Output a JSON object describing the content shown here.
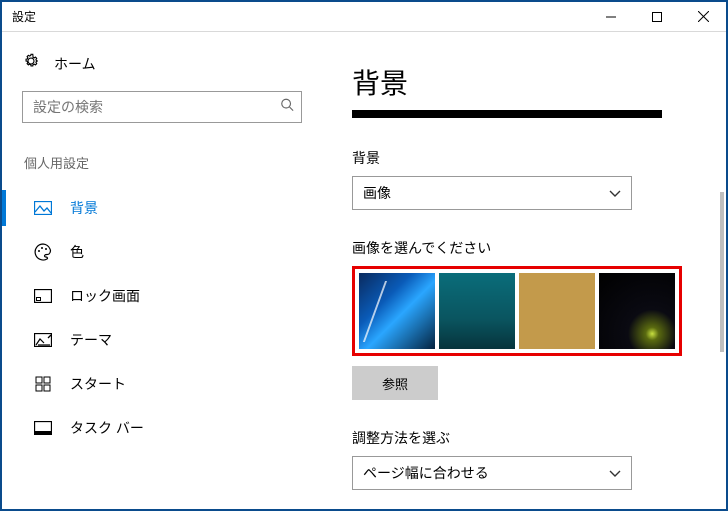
{
  "window": {
    "title": "設定"
  },
  "sidebar": {
    "home": "ホーム",
    "search_placeholder": "設定の検索",
    "section_header": "個人用設定",
    "items": [
      {
        "label": "背景",
        "icon": "picture-icon",
        "active": true
      },
      {
        "label": "色",
        "icon": "palette-icon"
      },
      {
        "label": "ロック画面",
        "icon": "lockscreen-icon"
      },
      {
        "label": "テーマ",
        "icon": "theme-icon"
      },
      {
        "label": "スタート",
        "icon": "start-icon"
      },
      {
        "label": "タスク バー",
        "icon": "taskbar-icon"
      }
    ]
  },
  "content": {
    "page_title": "背景",
    "bg_label": "背景",
    "bg_value": "画像",
    "choose_label": "画像を選んでください",
    "browse_label": "参照",
    "fit_label": "調整方法を選ぶ",
    "fit_value": "ページ幅に合わせる"
  }
}
